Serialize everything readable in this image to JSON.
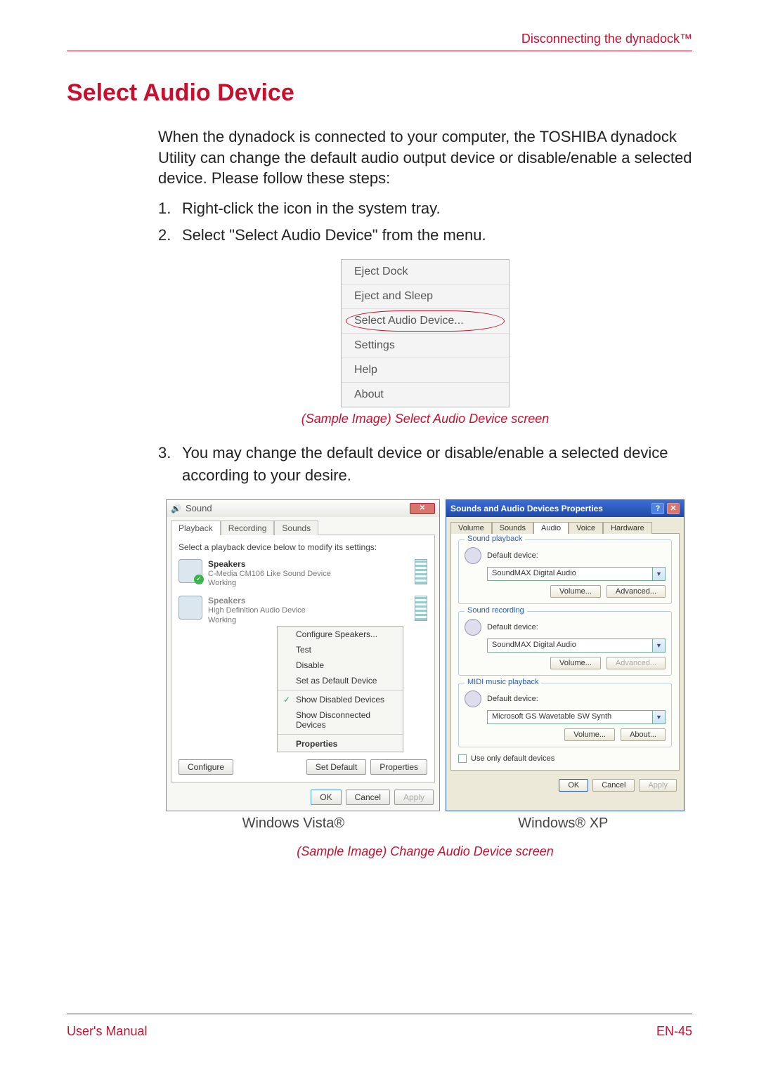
{
  "header": {
    "right": "Disconnecting the dynadock™"
  },
  "title": "Select Audio Device",
  "intro": "When the dynadock is connected to your computer, the TOSHIBA dynadock Utility can change the default audio output device or disable/enable a selected device. Please follow these steps:",
  "steps": {
    "1": "Right-click the icon in the system tray.",
    "2": "Select \"Select Audio Device\" from the menu.",
    "3": "You may change the default device or disable/enable a selected device according to your desire."
  },
  "menu": {
    "items": [
      "Eject Dock",
      "Eject and Sleep",
      "Select Audio Device...",
      "Settings",
      "Help",
      "About"
    ],
    "highlighted_index": 2
  },
  "caption1": "(Sample Image) Select Audio Device screen",
  "vista": {
    "window_title": "Sound",
    "tabs": [
      "Playback",
      "Recording",
      "Sounds"
    ],
    "active_tab": 0,
    "hint": "Select a playback device below to modify its settings:",
    "devices": [
      {
        "name": "Speakers",
        "sub": "C-Media CM106 Like Sound Device",
        "status": "Working",
        "default": true
      },
      {
        "name": "Speakers",
        "sub": "High Definition Audio Device",
        "status": "Working",
        "default": false
      }
    ],
    "context_menu": [
      {
        "label": "Configure Speakers..."
      },
      {
        "label": "Test"
      },
      {
        "label": "Disable"
      },
      {
        "label": "Set as Default Device"
      },
      {
        "sep": true
      },
      {
        "label": "Show Disabled Devices",
        "checked": true
      },
      {
        "label": "Show Disconnected Devices"
      },
      {
        "sep": true
      },
      {
        "label": "Properties",
        "bold": true
      }
    ],
    "bottom_buttons": {
      "configure": "Configure",
      "set_default": "Set Default",
      "properties": "Properties"
    },
    "dialog_buttons": {
      "ok": "OK",
      "cancel": "Cancel",
      "apply": "Apply"
    }
  },
  "xp": {
    "window_title": "Sounds and Audio Devices Properties",
    "tabs": [
      "Volume",
      "Sounds",
      "Audio",
      "Voice",
      "Hardware"
    ],
    "active_tab": 2,
    "groups": {
      "playback": {
        "title": "Sound playback",
        "label": "Default device:",
        "value": "SoundMAX Digital Audio",
        "btn1": "Volume...",
        "btn2": "Advanced..."
      },
      "recording": {
        "title": "Sound recording",
        "label": "Default device:",
        "value": "SoundMAX Digital Audio",
        "btn1": "Volume...",
        "btn2": "Advanced..."
      },
      "midi": {
        "title": "MIDI music playback",
        "label": "Default device:",
        "value": "Microsoft GS Wavetable SW Synth",
        "btn1": "Volume...",
        "btn2": "About..."
      }
    },
    "checkbox": "Use only default devices",
    "dialog_buttons": {
      "ok": "OK",
      "cancel": "Cancel",
      "apply": "Apply"
    }
  },
  "os_labels": {
    "vista": "Windows Vista®",
    "xp": "Windows® XP"
  },
  "caption2": "(Sample Image) Change Audio Device screen",
  "footer": {
    "left": "User's Manual",
    "right": "EN-45"
  }
}
